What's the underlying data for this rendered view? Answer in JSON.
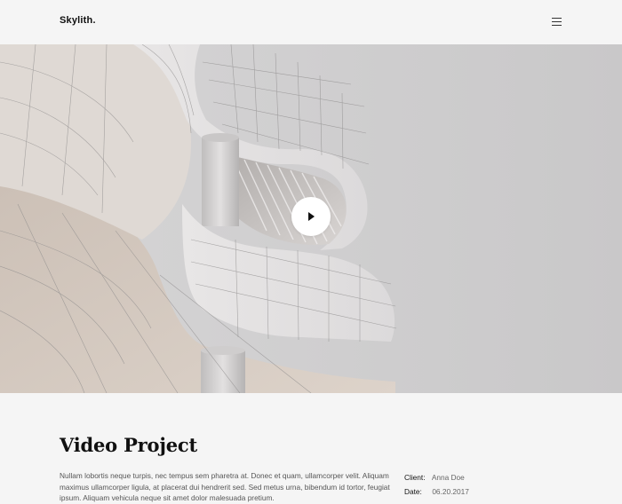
{
  "header": {
    "logo": "Skylith.",
    "menu_icon": "hamburger-menu-icon"
  },
  "hero": {
    "play_icon": "play-icon"
  },
  "project": {
    "title": "Video Project",
    "description": "Nullam lobortis neque turpis, nec tempus sem pharetra at. Donec et quam, ullamcorper velit. Aliquam maximus ullamcorper ligula, at placerat dui hendrerit sed. Sed metus urna, bibendum id tortor, feugiat ipsum. Aliquam vehicula neque sit amet dolor malesuada pretium.",
    "meta": [
      {
        "label": "Client:",
        "value": "Anna Doe"
      },
      {
        "label": "Date:",
        "value": "06.20.2017"
      }
    ]
  }
}
